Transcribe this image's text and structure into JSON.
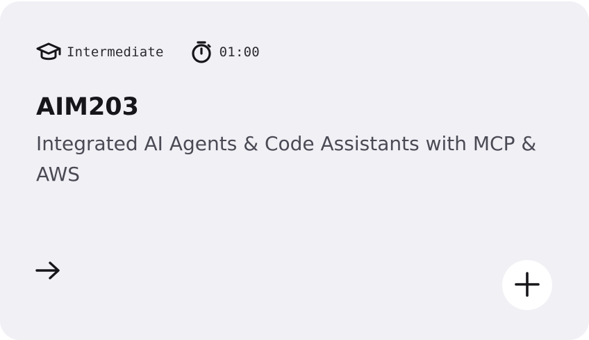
{
  "card": {
    "level": {
      "icon": "graduation-cap-icon",
      "label": "Intermediate"
    },
    "duration": {
      "icon": "stopwatch-icon",
      "label": "01:00"
    },
    "code": "AIM203",
    "title": "Integrated AI Agents & Code Assistants with MCP & AWS",
    "actions": {
      "open_icon": "arrow-right-icon",
      "add_icon": "plus-icon"
    }
  },
  "colors": {
    "card_background": "#f1f0f5",
    "code_text": "#16161a",
    "title_text": "#4a4a55",
    "button_background": "#ffffff"
  }
}
